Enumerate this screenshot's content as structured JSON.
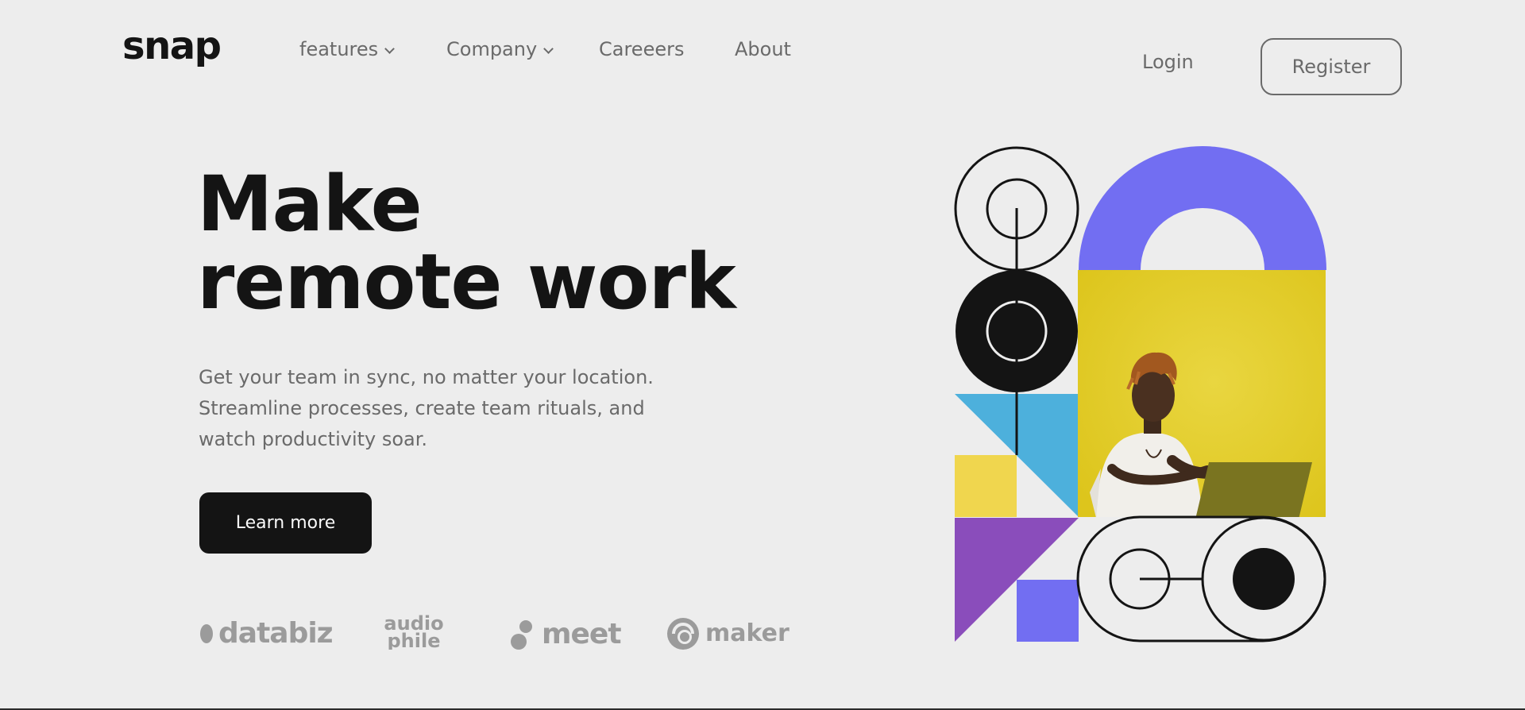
{
  "brand": {
    "logo_text": "snap"
  },
  "nav": {
    "items": [
      {
        "label": "features",
        "has_dropdown": true
      },
      {
        "label": "Company",
        "has_dropdown": true
      },
      {
        "label": "Careeers",
        "has_dropdown": false
      },
      {
        "label": "About",
        "has_dropdown": false
      }
    ],
    "login_label": "Login",
    "register_label": "Register"
  },
  "hero": {
    "headline_line1": "Make",
    "headline_line2": "remote work",
    "description_lines": [
      "Get your team in sync, no matter your location.",
      "Streamline processes, create team rituals, and",
      "watch productivity soar."
    ],
    "cta_label": "Learn more"
  },
  "clients": [
    {
      "name": "databiz",
      "icon": "databiz-logo-icon"
    },
    {
      "name": "audiophile",
      "icon": "audiophile-logo-icon"
    },
    {
      "name": "meet",
      "icon": "meet-logo-icon"
    },
    {
      "name": "maker",
      "icon": "maker-logo-icon"
    }
  ],
  "colors": {
    "background": "#ededed",
    "text_dark": "#141414",
    "text_muted": "#6a6a6a",
    "client_gray": "#9b9b9b",
    "purple": "#726ef2",
    "yellow": "#e6d030",
    "yellow_light": "#f0d64e",
    "blue": "#4db0dc",
    "violet": "#8a4dbb"
  }
}
